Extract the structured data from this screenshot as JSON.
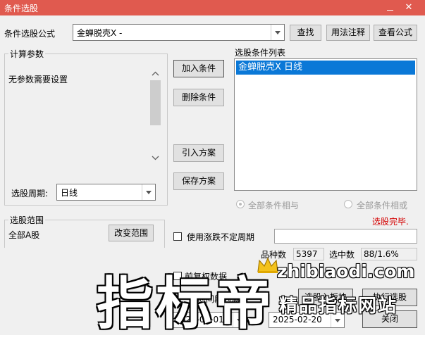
{
  "window": {
    "title": "条件选股"
  },
  "formula": {
    "label": "条件选股公式",
    "value": "金蝉脱壳X  -",
    "find_button": "查找",
    "usage_button": "用法注释",
    "view_button": "查看公式"
  },
  "params": {
    "title": "计算参数",
    "text": "无参数需要设置"
  },
  "period": {
    "label": "选股周期:",
    "value": "日线"
  },
  "actions": {
    "add": "加入条件",
    "delete": "删除条件",
    "import": "引入方案",
    "save": "保存方案"
  },
  "condition_list": {
    "title": "选股条件列表",
    "items": [
      "金蝉脱壳X  日线"
    ]
  },
  "logic": {
    "all_and": "全部条件相与",
    "all_or": "全部条件相或",
    "selected": "all_and"
  },
  "status": {
    "text": "选股完毕.",
    "color": "#d40000"
  },
  "range": {
    "title": "选股范围",
    "value": "全部A股",
    "change_button": "改变范围"
  },
  "period_option": {
    "label": "使用涨跌不定周期",
    "checked": false,
    "value": ""
  },
  "stats": {
    "count_label": "品种数",
    "count_value": "5397",
    "selected_label": "选中数",
    "selected_value": "88/1.6%"
  },
  "partial": {
    "rights_label": "前复权数据",
    "interval_label": "时间段内满足",
    "into_block_button": "选股入板块",
    "run_button": "执行选股"
  },
  "dates": {
    "start": "2025-02-01",
    "separator": "-",
    "end": "2025-02-20"
  },
  "close_button": "关闭",
  "watermark": {
    "big": "指标帝",
    "url": "zhibiaodi.com",
    "sub": "精品指标网站"
  },
  "colors": {
    "titlebar": "#e05a4f",
    "selection": "#0a78d7"
  }
}
